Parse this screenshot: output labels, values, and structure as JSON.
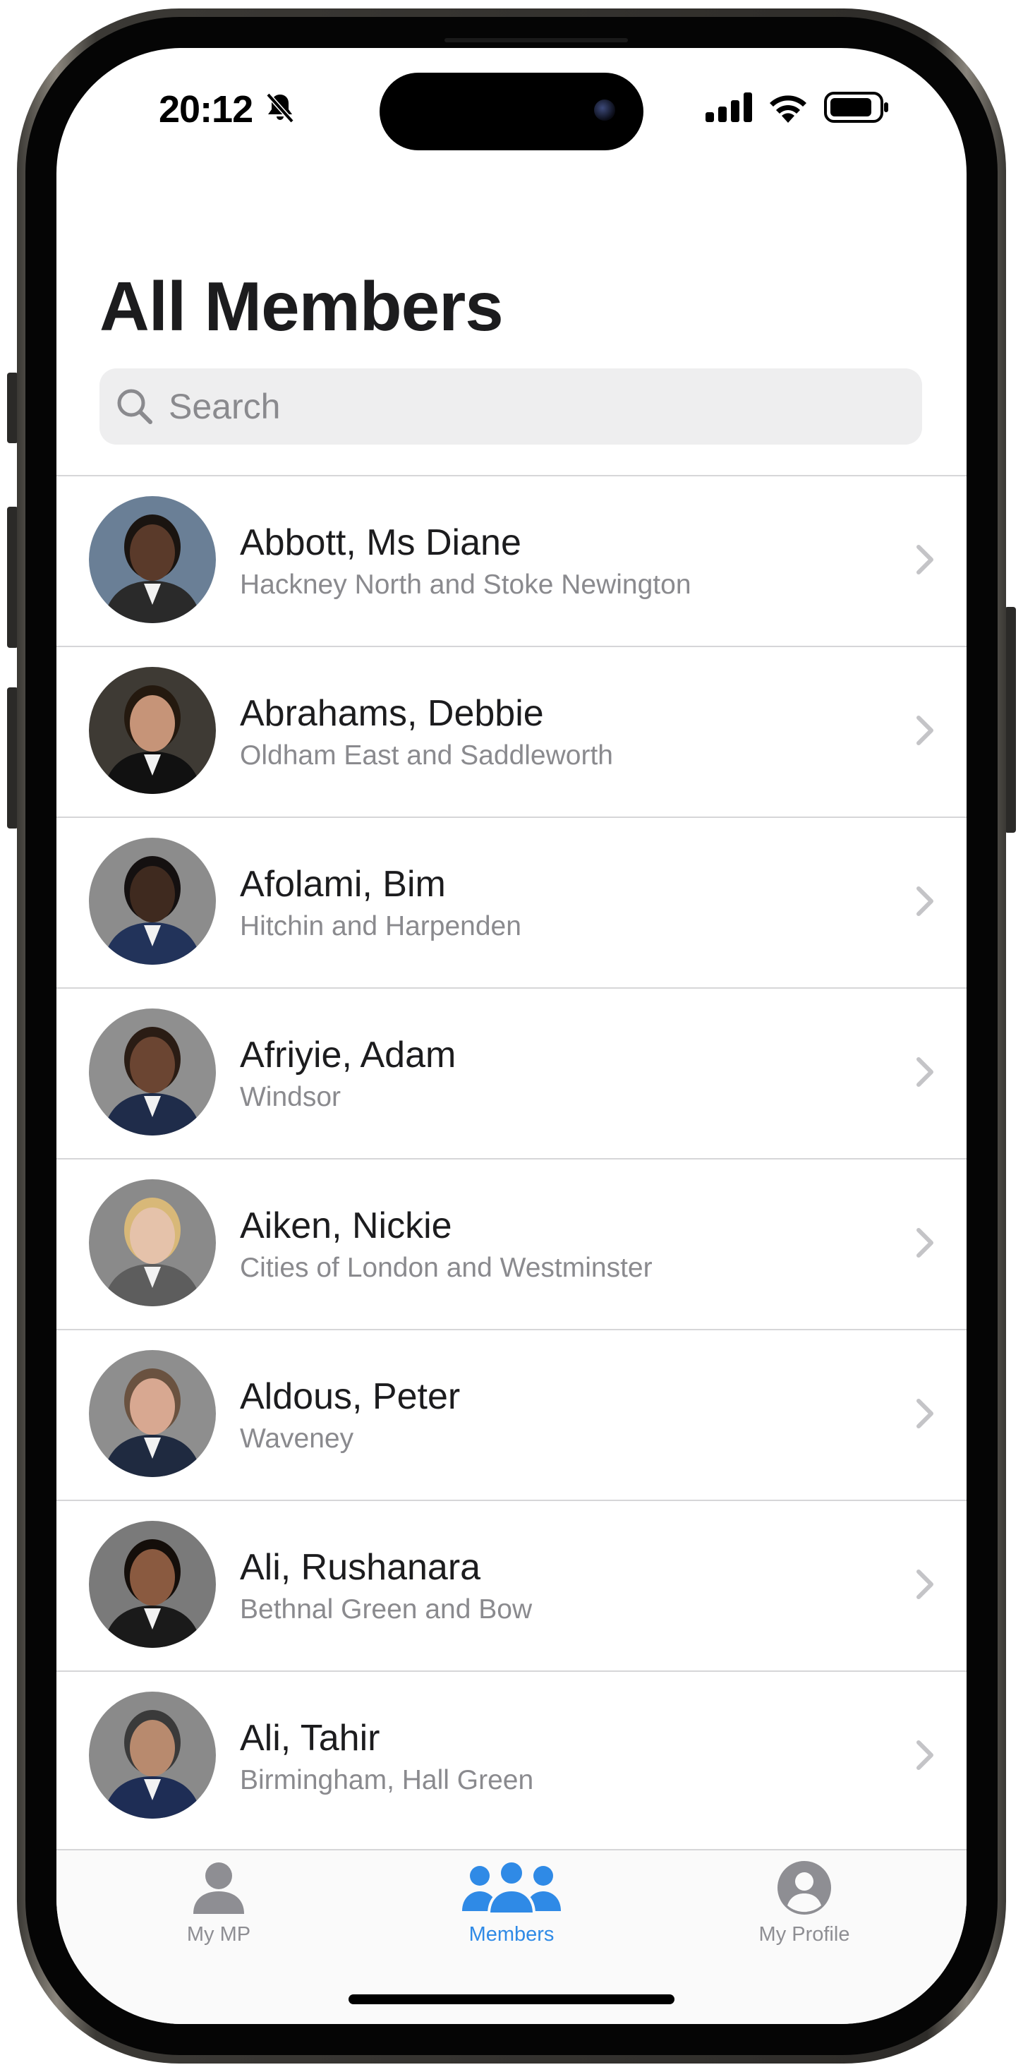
{
  "status_bar": {
    "time": "20:12",
    "icons": [
      "bell-slash-icon",
      "cellular-signal-icon",
      "wifi-icon",
      "battery-icon"
    ]
  },
  "header": {
    "title": "All Members",
    "search_placeholder": "Search",
    "search_value": ""
  },
  "members": [
    {
      "name": "Abbott, Ms Diane",
      "constituency": "Hackney North and Stoke Newington",
      "avatar_bg": "#6a7f96",
      "skin": "#5a3a2a",
      "hair": "#1a1410",
      "suit": "#2a2a2a"
    },
    {
      "name": "Abrahams, Debbie",
      "constituency": "Oldham East and Saddleworth",
      "avatar_bg": "#3e3a34",
      "skin": "#c69478",
      "hair": "#24190f",
      "suit": "#111111"
    },
    {
      "name": "Afolami, Bim",
      "constituency": "Hitchin and Harpenden",
      "avatar_bg": "#8c8c8c",
      "skin": "#3f2a1f",
      "hair": "#141010",
      "suit": "#22335a"
    },
    {
      "name": "Afriyie, Adam",
      "constituency": "Windsor",
      "avatar_bg": "#8f8f8f",
      "skin": "#6b4532",
      "hair": "#2a1c14",
      "suit": "#1f2c4a"
    },
    {
      "name": "Aiken, Nickie",
      "constituency": "Cities of London and Westminster",
      "avatar_bg": "#8a8a8a",
      "skin": "#e5c2aa",
      "hair": "#d8b878",
      "suit": "#5d5d5d"
    },
    {
      "name": "Aldous, Peter",
      "constituency": "Waveney",
      "avatar_bg": "#8e8e8e",
      "skin": "#d8a891",
      "hair": "#6a5240",
      "suit": "#1f2a40"
    },
    {
      "name": "Ali, Rushanara",
      "constituency": "Bethnal Green and Bow",
      "avatar_bg": "#7a7a7a",
      "skin": "#8a5a40",
      "hair": "#140e0a",
      "suit": "#1a1a1a"
    },
    {
      "name": "Ali, Tahir",
      "constituency": "Birmingham, Hall Green",
      "avatar_bg": "#8a8a8a",
      "skin": "#b88a6e",
      "hair": "#3a3a3a",
      "suit": "#1e2d55"
    }
  ],
  "tabbar": {
    "tabs": [
      {
        "label": "My MP",
        "icon": "person-icon",
        "active": false
      },
      {
        "label": "Members",
        "icon": "people-icon",
        "active": true
      },
      {
        "label": "My Profile",
        "icon": "profile-circle-icon",
        "active": false
      }
    ],
    "active_color": "#2f8ae6",
    "inactive_color": "#8e8e93"
  }
}
